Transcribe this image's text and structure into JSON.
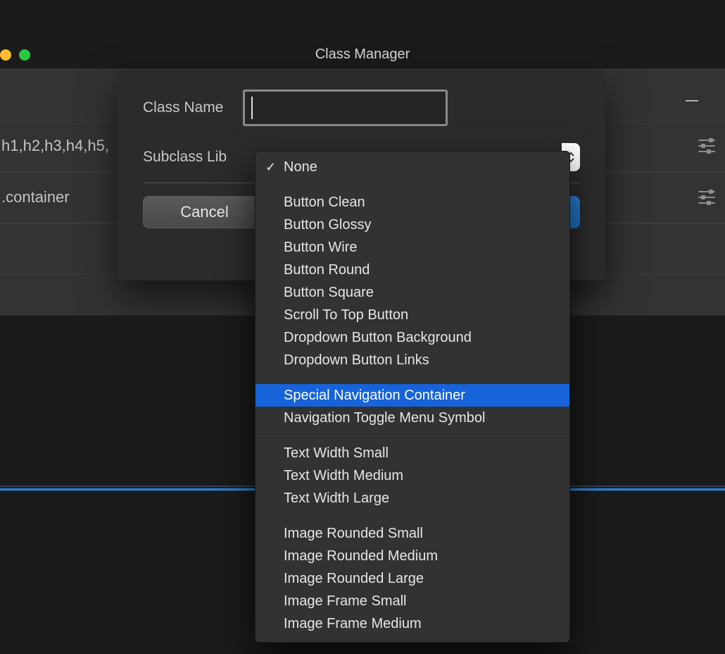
{
  "window": {
    "title": "Class Manager"
  },
  "side_rows": {
    "r1": "h1,h2,h3,h4,h5,",
    "r2": ".container"
  },
  "top_right": {
    "dash": "—"
  },
  "dialog": {
    "class_name_label": "Class Name",
    "class_name_value": "",
    "subclass_lib_label": "Subclass Lib",
    "cancel": "Cancel"
  },
  "dropdown": {
    "none": "None",
    "group1": [
      "Button Clean",
      "Button Glossy",
      "Button Wire",
      "Button Round",
      "Button Square",
      "Scroll To Top Button",
      "Dropdown Button Background",
      "Dropdown Button Links"
    ],
    "group2": [
      "Special Navigation Container",
      "Navigation Toggle Menu Symbol"
    ],
    "group2_selected_index": 0,
    "group3": [
      "Text Width Small",
      "Text Width Medium",
      "Text Width Large"
    ],
    "group4": [
      "Image Rounded Small",
      "Image Rounded Medium",
      "Image Rounded Large",
      "Image Frame Small",
      "Image Frame Medium"
    ]
  }
}
